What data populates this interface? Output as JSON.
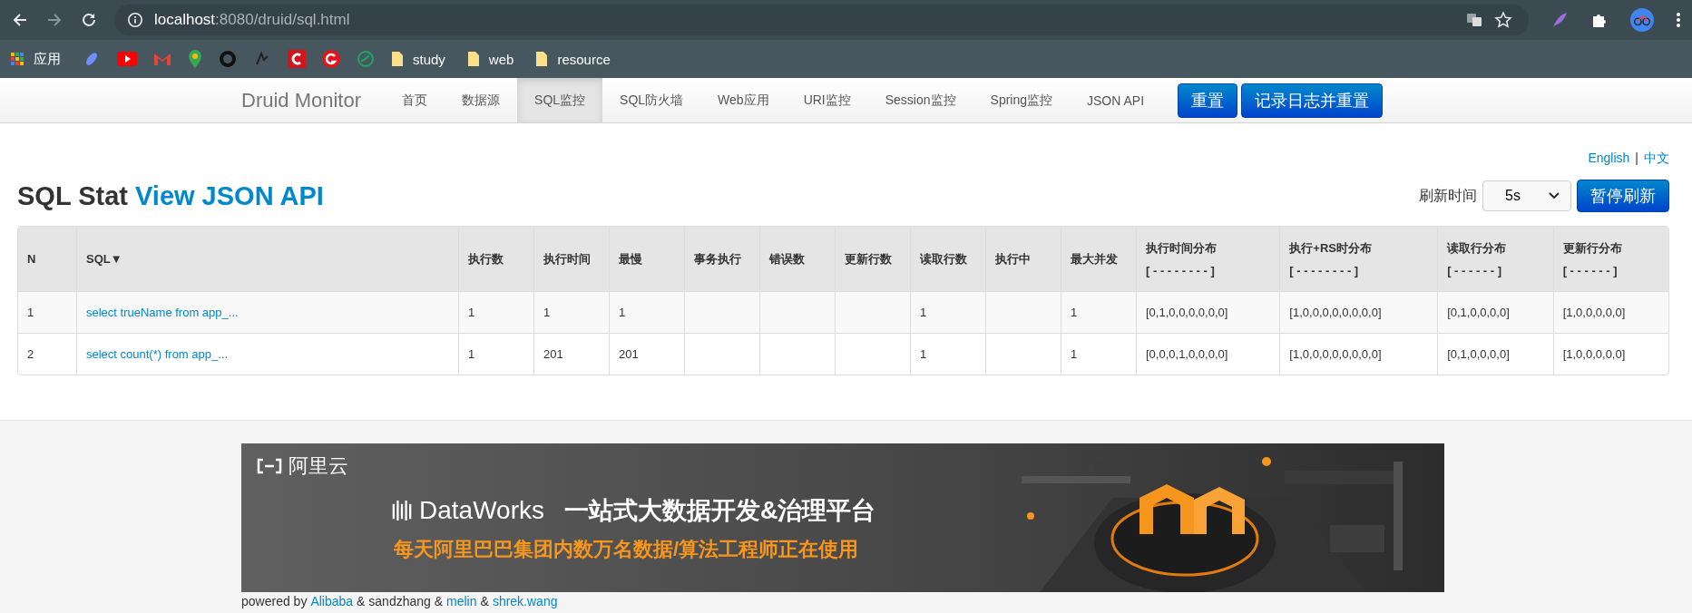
{
  "browser": {
    "url_host": "localhost",
    "url_rest": ":8080/druid/sql.html",
    "bookmarks": [
      {
        "kind": "apps",
        "label": "应用"
      },
      {
        "kind": "rocket"
      },
      {
        "kind": "play"
      },
      {
        "kind": "mail"
      },
      {
        "kind": "pin"
      },
      {
        "kind": "cat"
      },
      {
        "kind": "sketch"
      },
      {
        "kind": "c"
      },
      {
        "kind": "g"
      },
      {
        "kind": "ring"
      },
      {
        "kind": "folder",
        "label": "study"
      },
      {
        "kind": "folder",
        "label": "web"
      },
      {
        "kind": "folder",
        "label": "resource"
      }
    ]
  },
  "nav": {
    "brand": "Druid Monitor",
    "items": [
      {
        "label": "首页",
        "selected": false
      },
      {
        "label": "数据源",
        "selected": false
      },
      {
        "label": "SQL监控",
        "selected": true
      },
      {
        "label": "SQL防火墙",
        "selected": false
      },
      {
        "label": "Web应用",
        "selected": false
      },
      {
        "label": "URI监控",
        "selected": false
      },
      {
        "label": "Session监控",
        "selected": false
      },
      {
        "label": "Spring监控",
        "selected": false
      },
      {
        "label": "JSON API",
        "selected": false
      }
    ],
    "buttons": [
      "重置",
      "记录日志并重置"
    ]
  },
  "languages": {
    "items": [
      "English",
      "中文"
    ],
    "separator": "|"
  },
  "heading": {
    "title": "SQL Stat",
    "link": "View JSON API"
  },
  "refresh": {
    "label": "刷新时间",
    "value": "5s",
    "button": "暂停刷新"
  },
  "table": {
    "columns": [
      {
        "label": "N"
      },
      {
        "label": "SQL▼"
      },
      {
        "label": "执行数"
      },
      {
        "label": "执行时间"
      },
      {
        "label": "最慢"
      },
      {
        "label": "事务执行"
      },
      {
        "label": "错误数"
      },
      {
        "label": "更新行数"
      },
      {
        "label": "读取行数"
      },
      {
        "label": "执行中"
      },
      {
        "label": "最大并发"
      },
      {
        "label": "执行时间分布",
        "sub": "[ - - - - - - - - ]"
      },
      {
        "label": "执行+RS时分布",
        "sub": "[ - - - - - - - - ]"
      },
      {
        "label": "读取行分布",
        "sub": "[ - - - - - - ]"
      },
      {
        "label": "更新行分布",
        "sub": "[ - - - - - - ]"
      }
    ],
    "rows": [
      [
        "1",
        "select trueName from app_...",
        "1",
        "1",
        "1",
        "",
        "",
        "",
        "1",
        "",
        "1",
        "[0,1,0,0,0,0,0,0]",
        "[1,0,0,0,0,0,0,0,0]",
        "[0,1,0,0,0,0]",
        "[1,0,0,0,0,0]"
      ],
      [
        "2",
        "select count(*) from app_...",
        "1",
        "201",
        "201",
        "",
        "",
        "",
        "1",
        "",
        "1",
        "[0,0,0,1,0,0,0,0]",
        "[1,0,0,0,0,0,0,0,0]",
        "[0,1,0,0,0,0]",
        "[1,0,0,0,0,0]"
      ]
    ]
  },
  "banner": {
    "logo": "阿里云",
    "product": "DataWorks",
    "headline": "一站式大数据开发&治理平台",
    "tagline": "每天阿里巴巴集团内数万名数据/算法工程师正在使用"
  },
  "footer": [
    {
      "kind": "text",
      "text": "powered by"
    },
    {
      "kind": "link",
      "text": "Alibaba"
    },
    {
      "kind": "text",
      "text": "& sandzhang &"
    },
    {
      "kind": "link",
      "text": "melin"
    },
    {
      "kind": "text",
      "text": "&"
    },
    {
      "kind": "link",
      "text": "shrek.wang"
    }
  ]
}
